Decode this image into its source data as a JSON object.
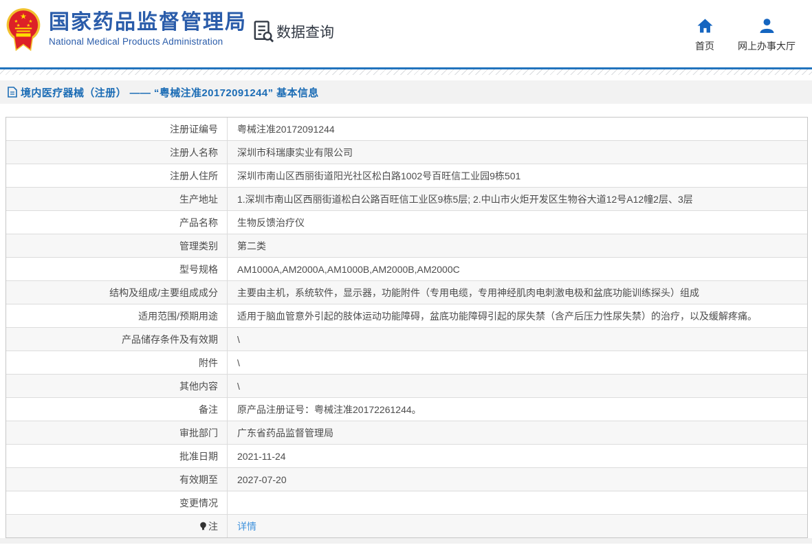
{
  "header": {
    "brand": {
      "title_cn": "国家药品监督管理局",
      "title_en": "National Medical Products Administration"
    },
    "section_label": "数据查询",
    "nav": [
      {
        "label": "首页",
        "icon": "home-icon"
      },
      {
        "label": "网上办事大厅",
        "icon": "person-icon"
      }
    ]
  },
  "page_title": "境内医疗器械（注册） —— “粤械注准20172091244” 基本信息",
  "table": {
    "rows": [
      {
        "label": "注册证编号",
        "value": "粤械注准20172091244"
      },
      {
        "label": "注册人名称",
        "value": "深圳市科瑞康实业有限公司"
      },
      {
        "label": "注册人住所",
        "value": "深圳市南山区西丽街道阳光社区松白路1002号百旺信工业园9栋501"
      },
      {
        "label": "生产地址",
        "value": "1.深圳市南山区西丽街道松白公路百旺信工业区9栋5层; 2.中山市火炬开发区生物谷大道12号A12幢2层、3层"
      },
      {
        "label": "产品名称",
        "value": "生物反馈治疗仪"
      },
      {
        "label": "管理类别",
        "value": "第二类"
      },
      {
        "label": "型号规格",
        "value": "AM1000A,AM2000A,AM1000B,AM2000B,AM2000C"
      },
      {
        "label": "结构及组成/主要组成成分",
        "value": "主要由主机，系统软件，显示器，功能附件（专用电缆，专用神经肌肉电刺激电极和盆底功能训练探头）组成"
      },
      {
        "label": "适用范围/预期用途",
        "value": "适用于脑血管意外引起的肢体运动功能障碍，盆底功能障碍引起的尿失禁（含产后压力性尿失禁）的治疗，以及缓解疼痛。"
      },
      {
        "label": "产品储存条件及有效期",
        "value": "\\"
      },
      {
        "label": "附件",
        "value": "\\"
      },
      {
        "label": "其他内容",
        "value": "\\"
      },
      {
        "label": "备注",
        "value": "原产品注册证号：粤械注准20172261244。"
      },
      {
        "label": "审批部门",
        "value": "广东省药品监督管理局"
      },
      {
        "label": "批准日期",
        "value": "2021-11-24"
      },
      {
        "label": "有效期至",
        "value": "2027-07-20"
      },
      {
        "label": "变更情况",
        "value": ""
      },
      {
        "label": "注",
        "value": "详情",
        "label_icon": "bulb-icon",
        "value_link": true
      }
    ]
  },
  "colors": {
    "brand_blue": "#2a5caa",
    "nav_icon_blue": "#1565c0",
    "divider_blue": "#2173bd",
    "title_blue": "#1b6cb5",
    "link_blue": "#4193dd",
    "row_alt_bg": "#f7f7f7",
    "text_dark": "#4c4c4c",
    "emblem_red": "#dd2127",
    "emblem_gold": "#f2c12e"
  }
}
